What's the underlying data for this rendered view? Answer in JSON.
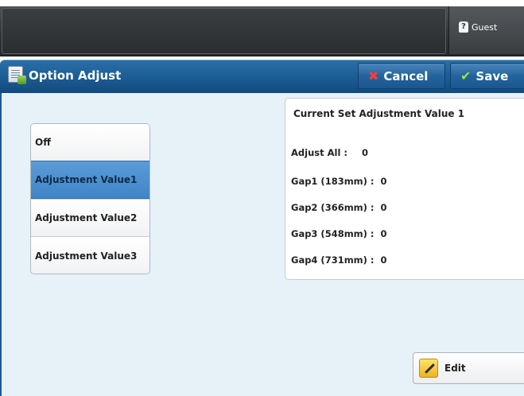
{
  "header": {
    "user_label": "Guest"
  },
  "titlebar": {
    "title": "Option Adjust",
    "cancel_label": "Cancel",
    "save_label": "Save"
  },
  "options": [
    {
      "label": "Off",
      "selected": false
    },
    {
      "label": "Adjustment Value1",
      "selected": true
    },
    {
      "label": "Adjustment Value2",
      "selected": false
    },
    {
      "label": "Adjustment Value3",
      "selected": false
    }
  ],
  "panel": {
    "title": "Current Set Adjustment Value 1",
    "rows": [
      {
        "label": "Adjust All :",
        "value": "0"
      },
      {
        "label": "Gap1 (183mm) :",
        "value": "0"
      },
      {
        "label": "Gap2 (366mm) :",
        "value": "0"
      },
      {
        "label": "Gap3 (548mm) :",
        "value": "0"
      },
      {
        "label": "Gap4 (731mm) :",
        "value": "0"
      }
    ]
  },
  "edit_label": "Edit",
  "colors": {
    "accent": "#1b5b93",
    "selected": "#4a8fce",
    "background": "#e6f2f8"
  },
  "icons": {
    "user": "user-icon",
    "title": "option-adjust-icon",
    "cancel": "cancel-x-icon",
    "save": "checkmark-icon",
    "edit": "pencil-icon"
  }
}
